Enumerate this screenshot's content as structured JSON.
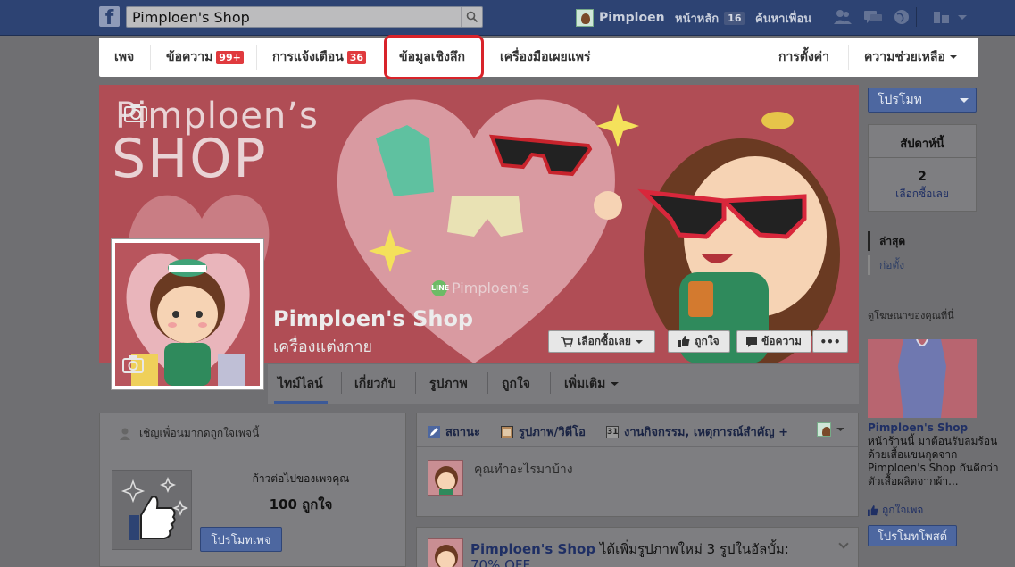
{
  "topbar": {
    "search_value": "Pimploen's Shop",
    "user_name": "Pimploen",
    "home_label": "หน้าหลัก",
    "home_count": "16",
    "find_friends": "ค้นหาเพื่อน"
  },
  "admin_nav": {
    "page": "เพจ",
    "messages": "ข้อความ",
    "messages_badge": "99+",
    "notifications": "การแจ้งเตือน",
    "notifications_badge": "36",
    "insights": "ข้อมูลเชิงลึก",
    "publishing_tools": "เครื่องมือเผยแพร่",
    "settings": "การตั้งค่า",
    "help": "ความช่วยเหลือ"
  },
  "cover": {
    "title_line1": "Pimploen’s",
    "title_line2": "SHOP",
    "brand": "Pimploen’s",
    "brand_icon": "LINE",
    "page_name": "Pimploen's Shop",
    "category": "เครื่องแต่งกาย",
    "shop_now": "เลือกซื้อเลย",
    "like": "ถูกใจ",
    "message": "ข้อความ",
    "more": "•••"
  },
  "tabs": {
    "timeline": "ไทม์ไลน์",
    "about": "เกี่ยวกับ",
    "photos": "รูปภาพ",
    "likes": "ถูกใจ",
    "more": "เพิ่มเติม"
  },
  "right_column": {
    "promote": "โปรโมท",
    "week_title": "สัปดาห์นี้",
    "week_count": "2",
    "week_label": "เลือกซื้อเลย",
    "year_latest": "ล่าสุด",
    "year_older": "ก่อตั้ง",
    "ad_heading": "ดูโฆษณาของคุณที่นี่",
    "ad_title": "Pimploen's Shop",
    "ad_body": "หน้าร้านนี้ มาต้อนรับลมร้อนด้วยเสื้อแขนกุดจาก Pimploen's Shop กันดีกว่า ตัวเสื้อผลิตจากผ้า...",
    "ad_like": "ถูกใจเพจ",
    "promote_post": "โปรโมทโพสต์"
  },
  "invite_card": {
    "heading": "เชิญเพื่อนมากดถูกใจเพจนี้",
    "subtitle": "ก้าวต่อไปของเพจคุณ",
    "goal": "100 ถูกใจ",
    "button": "โปรโมทเพจ"
  },
  "composer": {
    "status": "สถานะ",
    "photo_video": "รูปภาพ/วิดีโอ",
    "event_icon_text": "31",
    "event": "งานกิจกรรม, เหตุการณ์สำคัญ +",
    "placeholder": "คุณทำอะไรมาบ้าง"
  },
  "post": {
    "author": "Pimploen's Shop",
    "action": " ได้เพิ่มรูปภาพใหม่ 3 รูปในอัลบั้ม:",
    "line2": "70% OFF"
  },
  "colors": {
    "fb_blue": "#3b5998",
    "badge_red": "#e03a3e",
    "highlight_red": "#d8232a"
  }
}
